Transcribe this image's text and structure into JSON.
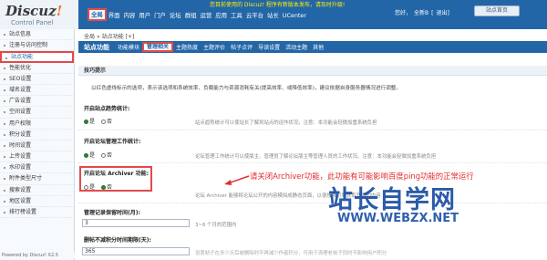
{
  "brand": {
    "name_main": "Discuz",
    "name_mark": "!",
    "subtitle": "Control Panel"
  },
  "header": {
    "notice": "您目前使用的 Discuz! 程序有新版本发布，请及时升级!",
    "user_greeting": "您好，",
    "username": "全新B",
    "separator": "[",
    "logout": "退出]",
    "site_home": "站点首页",
    "nav": [
      "全局",
      "界面",
      "内容",
      "用户",
      "门户",
      "论坛",
      "群组",
      "运营",
      "应用",
      "工具",
      "云平台",
      "站长",
      "UCenter"
    ],
    "active_nav_index": 0
  },
  "sidebar": {
    "items": [
      "站点信息",
      "注册与访问控制",
      "站点功能",
      "性能优化",
      "SEO设置",
      "域名设置",
      "广告设置",
      "空间设置",
      "用户权限",
      "积分设置",
      "时间设置",
      "上传设置",
      "水印设置",
      "附件类型尺寸",
      "搜索设置",
      "地区设置",
      "排行榜设置"
    ],
    "active_index": 2,
    "powered": "Powered by Discuz! X2.5"
  },
  "main": {
    "breadcrumb": {
      "root": "全局",
      "sep": "»",
      "page": "站点功能",
      "plus": "[+]"
    },
    "section_title": "站点功能",
    "tabs": [
      "功能模块",
      "管理相关",
      "主题热度",
      "主题评价",
      "帖子点评",
      "导读设置",
      "活动主题",
      "其他"
    ],
    "active_tab_index": 1,
    "tips_header": "技巧提示",
    "tip_text": "以红色虚线标示的选项，表示该选项和系统效率、负载能力与资源消耗有关(提高效率、或降低效率)，建议依据自身服务器情况进行调整。",
    "settings": [
      {
        "label": "开启站点趋势统计:",
        "yes": "是",
        "no": "否",
        "selected": "yes",
        "desc": "站点趋势统计可以使站长了解到站点的运作状况。注意：本功能会轻微加重系统负担"
      },
      {
        "label": "开启论坛管理工作统计:",
        "yes": "是",
        "no": "否",
        "selected": "yes",
        "desc": "论坛管理工作统计可以使版主、管理员了解论坛版主等管理人员的工作状况。注意：本功能会轻微加重系统负担"
      },
      {
        "label": "开启论坛 Archiver 功能:",
        "yes": "是",
        "no": "否",
        "selected": "no",
        "desc": "论坛 Archiver 能够将论坛公开的内容模拟成静态页面，以便搜索引擎获取其中的内容"
      }
    ],
    "fields": [
      {
        "label": "管理记录保留时间(月):",
        "value": "3",
        "desc": "3~6 个月的范围内"
      },
      {
        "label": "删帖不减积分时间期限(天):",
        "value": "365",
        "desc": "设置帖子在多少天后被删除时不再减少作者积分，可用于清理老帖子同时不影响用户积分"
      }
    ],
    "annotation": "请关闭Archiver功能，此功能有可能影响百度ping功能的正常运行"
  },
  "watermark": {
    "cn": "站长自学网",
    "url": "WWW.WEBZX.NET"
  },
  "colors": {
    "topbar": "#2366a8",
    "highlight": "#e24a4a",
    "annotation": "#e32b2b",
    "watermark": "#1b4fa3"
  }
}
